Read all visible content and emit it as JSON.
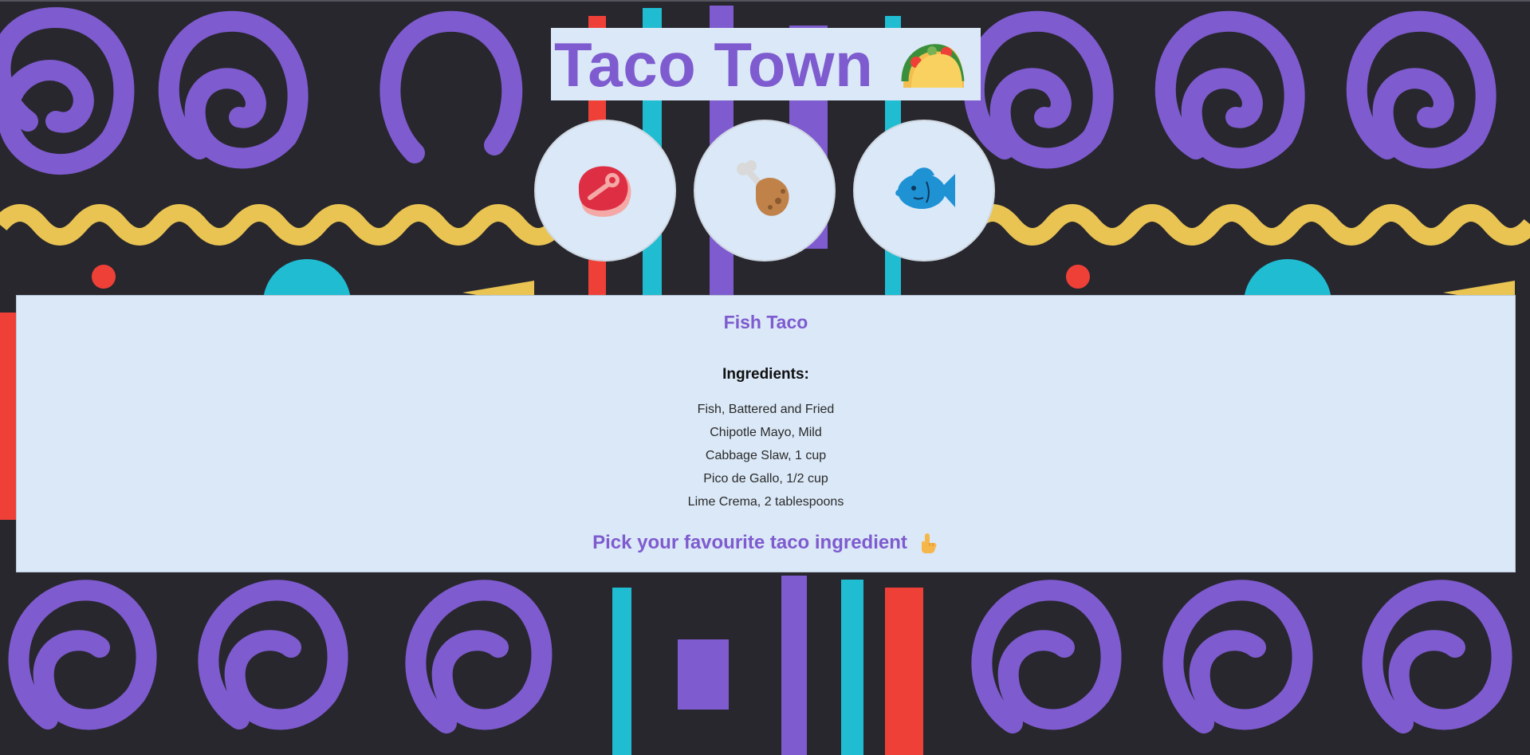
{
  "header": {
    "title": "Taco Town",
    "icon": "taco-icon"
  },
  "choices": [
    {
      "icon": "meat-icon",
      "name": "beef"
    },
    {
      "icon": "poultry-leg-icon",
      "name": "chicken"
    },
    {
      "icon": "fish-icon",
      "name": "fish"
    }
  ],
  "recipe": {
    "title": "Fish Taco",
    "ingredients_heading": "Ingredients:",
    "ingredients": [
      "Fish, Battered and Fried",
      "Chipotle Mayo, Mild",
      "Cabbage Slaw, 1 cup",
      "Pico de Gallo, 1/2 cup",
      "Lime Crema, 2 tablespoons"
    ]
  },
  "prompt": {
    "text": "Pick your favourite taco ingredient",
    "icon": "pointing-up-hand-icon"
  },
  "colors": {
    "background": "#28272e",
    "purple": "#7e5bcf",
    "yellow": "#e9c452",
    "red": "#ef4038",
    "cyan": "#1fbcd2",
    "panel": "#dae8f7"
  }
}
